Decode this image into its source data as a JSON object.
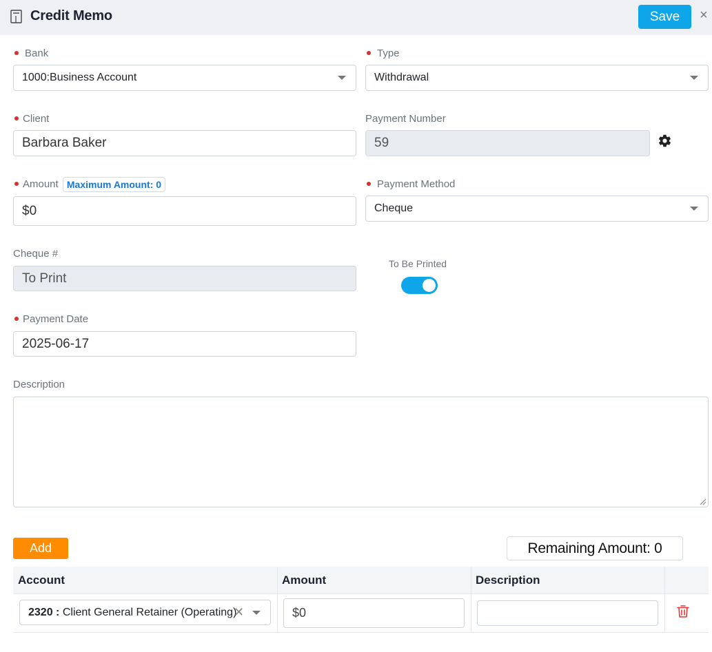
{
  "header": {
    "title": "Credit Memo",
    "save_label": "Save",
    "close_label": "×"
  },
  "form": {
    "bank": {
      "label": "Bank",
      "value": "1000:Business Account"
    },
    "type": {
      "label": "Type",
      "value": "Withdrawal"
    },
    "client": {
      "label": "Client",
      "value": "Barbara Baker"
    },
    "payment_number": {
      "label": "Payment Number",
      "value": "59"
    },
    "amount": {
      "label": "Amount",
      "badge": "Maximum Amount: 0",
      "value": "$0"
    },
    "payment_method": {
      "label": "Payment Method",
      "value": "Cheque"
    },
    "cheque": {
      "label": "Cheque #",
      "value": "To Print"
    },
    "to_be_printed": {
      "label": "To Be Printed",
      "on": true
    },
    "payment_date": {
      "label": "Payment Date",
      "value": "2025-06-17"
    },
    "description": {
      "label": "Description",
      "value": ""
    }
  },
  "lines": {
    "add_label": "Add",
    "remaining": "Remaining Amount: 0",
    "columns": {
      "account": "Account",
      "amount": "Amount",
      "description": "Description"
    },
    "rows": [
      {
        "account_code": "2320 :",
        "account_name": "Client General Retainer (Operating)",
        "amount": "$0",
        "description": ""
      }
    ]
  },
  "colors": {
    "primary": "#0fa5e9",
    "add": "#ff8c00",
    "required": "#d63031",
    "badge": "#1976d2",
    "delete": "#e53935"
  },
  "icons": [
    "memo-icon",
    "close-icon",
    "gear-icon",
    "chevron-down-icon",
    "clear-icon",
    "trash-icon",
    "resize-grip-icon"
  ]
}
